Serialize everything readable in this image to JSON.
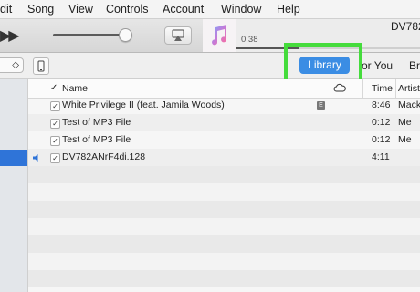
{
  "menubar": {
    "items": [
      "dit",
      "Song",
      "View",
      "Controls",
      "Account",
      "Window",
      "Help"
    ]
  },
  "player": {
    "elapsed": "0:38",
    "now_playing_title": "DV782",
    "progress_fraction": 0.34
  },
  "nav": {
    "select_value": "◇",
    "library_label": "Library",
    "for_you_label": "or You",
    "browse_label": "Br"
  },
  "table": {
    "headers": {
      "check": "✓",
      "name": "Name",
      "time": "Time",
      "artist": "Artist"
    },
    "rows": [
      {
        "name": "White Privilege II (feat. Jamila Woods)",
        "explicit": "E",
        "time": "8:46",
        "artist": "Mack"
      },
      {
        "name": "Test of MP3 File",
        "explicit": "",
        "time": "0:12",
        "artist": "Me"
      },
      {
        "name": "Test of MP3 File",
        "explicit": "",
        "time": "0:12",
        "artist": "Me"
      },
      {
        "name": "DV782ANrF4di.128",
        "explicit": "",
        "time": "4:11",
        "artist": ""
      }
    ]
  },
  "colors": {
    "accent": "#3b8de4",
    "highlight": "#45dc3c",
    "selection": "#2f74d8"
  }
}
